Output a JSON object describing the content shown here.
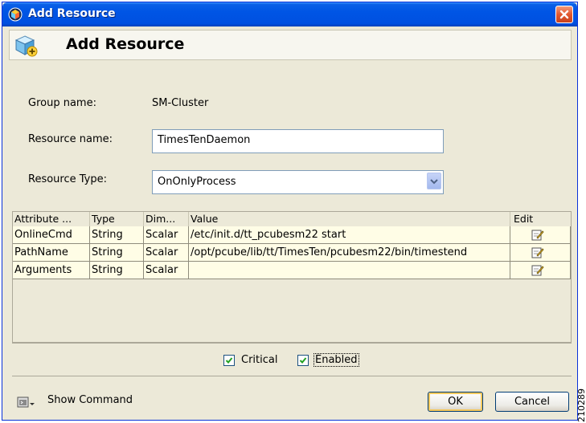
{
  "window": {
    "title": "Add Resource",
    "icon": "resource-cube-icon",
    "close_icon": "close-icon"
  },
  "header": {
    "title": "Add Resource",
    "icon": "add-resource-cube-icon"
  },
  "form": {
    "group_name_label": "Group name:",
    "group_name_value": "SM-Cluster",
    "resource_name_label": "Resource name:",
    "resource_name_value": "TimesTenDaemon",
    "resource_type_label": "Resource Type:",
    "resource_type_value": "OnOnlyProcess"
  },
  "attributes_table": {
    "columns": [
      "Attribute ...",
      "Type",
      "Dim...",
      "Value",
      "Edit"
    ],
    "rows": [
      {
        "name": "OnlineCmd",
        "type": "String",
        "dim": "Scalar",
        "value": "/etc/init.d/tt_pcubesm22 start",
        "edit_icon": "edit-icon"
      },
      {
        "name": "PathName",
        "type": "String",
        "dim": "Scalar",
        "value": "/opt/pcube/lib/tt/TimesTen/pcubesm22/bin/timestend",
        "edit_icon": "edit-icon"
      },
      {
        "name": "Arguments",
        "type": "String",
        "dim": "Scalar",
        "value": "",
        "edit_icon": "edit-icon"
      }
    ]
  },
  "options": {
    "critical_label": "Critical",
    "critical_checked": true,
    "enabled_label": "Enabled",
    "enabled_checked": true
  },
  "footer": {
    "show_command_label": "Show Command",
    "show_command_icon": "console-icon",
    "ok_label": "OK",
    "cancel_label": "Cancel"
  },
  "figure_id": "210289",
  "colors": {
    "titlebar": "#0055e5",
    "dialog_bg": "#ece9d8",
    "row_bg": "#fffde6",
    "close_button": "#e2582f"
  }
}
